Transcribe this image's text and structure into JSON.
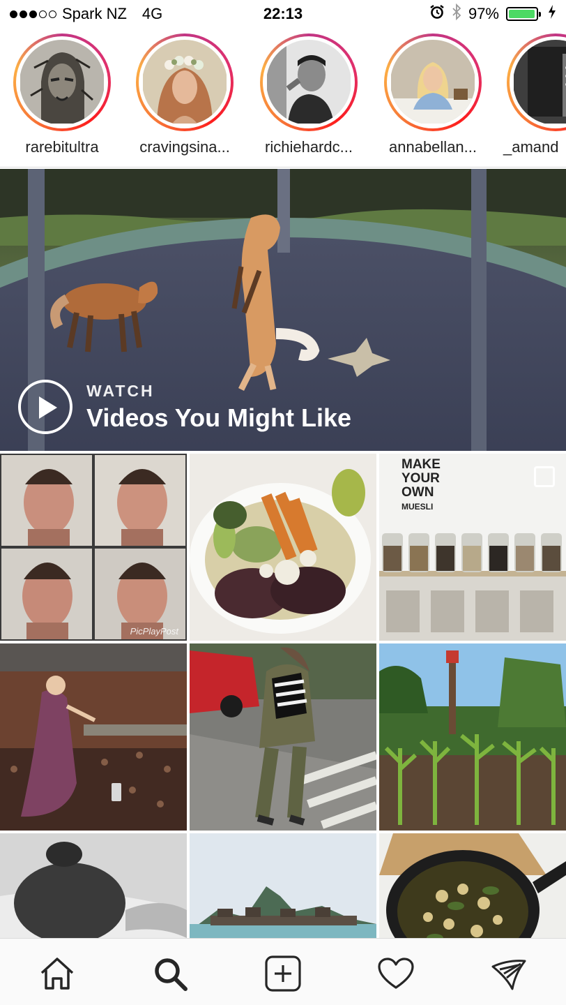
{
  "status_bar": {
    "carrier": "Spark NZ",
    "network": "4G",
    "time": "22:13",
    "battery": "97%",
    "battery_level": 0.97,
    "signal_bars": 3,
    "signal_total": 5
  },
  "stories": [
    {
      "username": "rarebitultra",
      "icon": "avatar-illustration"
    },
    {
      "username": "cravingsina...",
      "icon": "avatar-flower-crown"
    },
    {
      "username": "richiehardc...",
      "icon": "avatar-bw-portrait"
    },
    {
      "username": "annabellan...",
      "icon": "avatar-desk-portrait"
    },
    {
      "username": "_amand",
      "icon": "avatar-partial"
    }
  ],
  "featured": {
    "kicker": "WATCH",
    "title": "Videos You Might Like",
    "subject": "foxes on a trampoline"
  },
  "grid": {
    "muesli_lines": [
      "MAKE",
      "YOUR",
      "OWN",
      "MUESLI"
    ],
    "watermark": "PicPlayPost"
  },
  "nav": [
    "home-icon",
    "search-icon",
    "add-icon",
    "heart-icon",
    "direct-icon"
  ],
  "colors": {
    "story_ring": "#e1306c",
    "battery": "#4cd964",
    "nav_border": "#dbdbdb"
  }
}
